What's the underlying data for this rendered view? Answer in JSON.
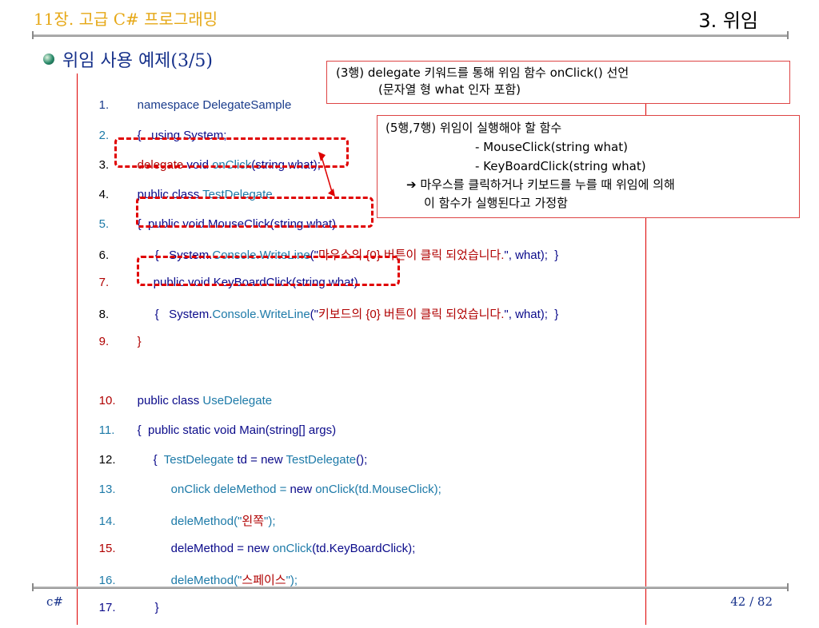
{
  "header": {
    "chapter": "11장. 고급 C# 프로그래밍",
    "section": "3. 위임"
  },
  "subtitle": "위임 사용 예제(3/5)",
  "code": [
    {
      "num": "1.",
      "text": "namespace DelegateSample"
    },
    {
      "num": "2.",
      "text": "{   using System;"
    },
    {
      "num": "3.",
      "kw": "delegate",
      "t1": " void ",
      "name": "onClick",
      "t2": "(string what);"
    },
    {
      "num": "4.",
      "t1": "public class ",
      "name": "TestDelegate"
    },
    {
      "num": "5.",
      "text": "{  public void MouseClick(string what)"
    },
    {
      "num": "6.",
      "t1": "{   System.",
      "name": "Console.WriteLine",
      "t2": "(\"",
      "str": "마우스의 {0} 버튼이 클릭 되었습니다.",
      "t3": "\", what);  }"
    },
    {
      "num": "7.",
      "text": "public void KeyBoardClick(string what)"
    },
    {
      "num": "8.",
      "t1": "{   System.",
      "name": "Console.WriteLine",
      "t2": "(\"",
      "str": "키보드의 {0} 버튼이 클릭 되었습니다.",
      "t3": "\", what);  }"
    },
    {
      "num": "9.",
      "text": "}"
    },
    {
      "num": "10.",
      "t1": "public class ",
      "name": "UseDelegate"
    },
    {
      "num": "11.",
      "text": "{  public static void Main(string[] args)"
    },
    {
      "num": "12.",
      "t1": "{  ",
      "name": "TestDelegate",
      "t2": " td = ",
      "kw": "new",
      "name2": " TestDelegate",
      "t3": "();"
    },
    {
      "num": "13.",
      "t1": "onClick deleMethod = ",
      "kw": "new",
      "name": " onClick",
      "t2": "(td.MouseClick);"
    },
    {
      "num": "14.",
      "t1": "deleMethod(\"",
      "str": "왼쪽",
      "t2": "\");"
    },
    {
      "num": "15.",
      "t1": "deleMethod = ",
      "kw": "new",
      "name": " onClick",
      "t2": "(td.KeyBoardClick);"
    },
    {
      "num": "16.",
      "t1": "deleMethod(\"",
      "str": "스페이스",
      "t2": "\");"
    },
    {
      "num": "17.",
      "text": "}"
    }
  ],
  "annotations": {
    "box1": {
      "line1": "(3행) delegate 키워드를 통해 위임 함수 onClick() 선언",
      "line2": "(문자열 형 what 인자 포함)"
    },
    "box2": {
      "line1": "(5행,7행) 위임이 실행해야 할 함수",
      "line2": "- MouseClick(string what)",
      "line3": "- KeyBoardClick(string what)",
      "line4": "➔ 마우스를 클릭하거나 키보드를 누를 때 위임에 의해",
      "line5": "이 함수가 실행된다고 가정함"
    }
  },
  "footer": {
    "left": "c#",
    "right": "42 / 82"
  }
}
